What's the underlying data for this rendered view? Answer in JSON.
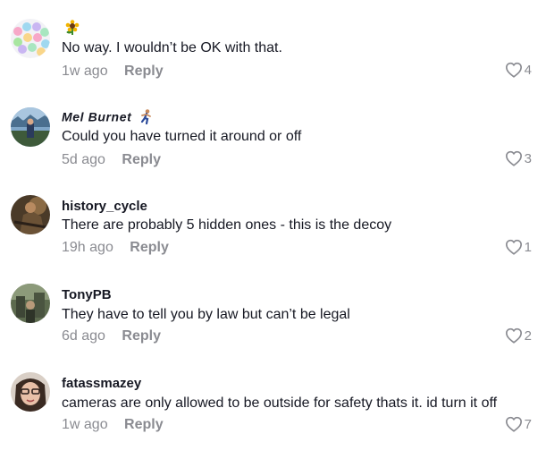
{
  "comments": [
    {
      "username": "",
      "flair": "sunflower",
      "text": "No way. I wouldn’t be OK with that.",
      "time": "1w ago",
      "reply_label": "Reply",
      "likes": "4"
    },
    {
      "username": "Mel Burnet",
      "flair": "runner",
      "text": "Could you have turned it around or off",
      "time": "5d ago",
      "reply_label": "Reply",
      "likes": "3"
    },
    {
      "username": "history_cycle",
      "flair": "",
      "text": "There are probably 5 hidden ones - this is the decoy",
      "time": "19h ago",
      "reply_label": "Reply",
      "likes": "1"
    },
    {
      "username": "TonyPB",
      "flair": "",
      "text": "They have to tell you by law but can’t be legal",
      "time": "6d ago",
      "reply_label": "Reply",
      "likes": "2"
    },
    {
      "username": "fatassmazey",
      "flair": "",
      "text": "cameras are only allowed to be outside for safety thats it. id turn it off",
      "time": "1w ago",
      "reply_label": "Reply",
      "likes": "7"
    }
  ],
  "colors": {
    "text": "#161823",
    "secondary": "#8a8b91",
    "background": "#ffffff"
  }
}
